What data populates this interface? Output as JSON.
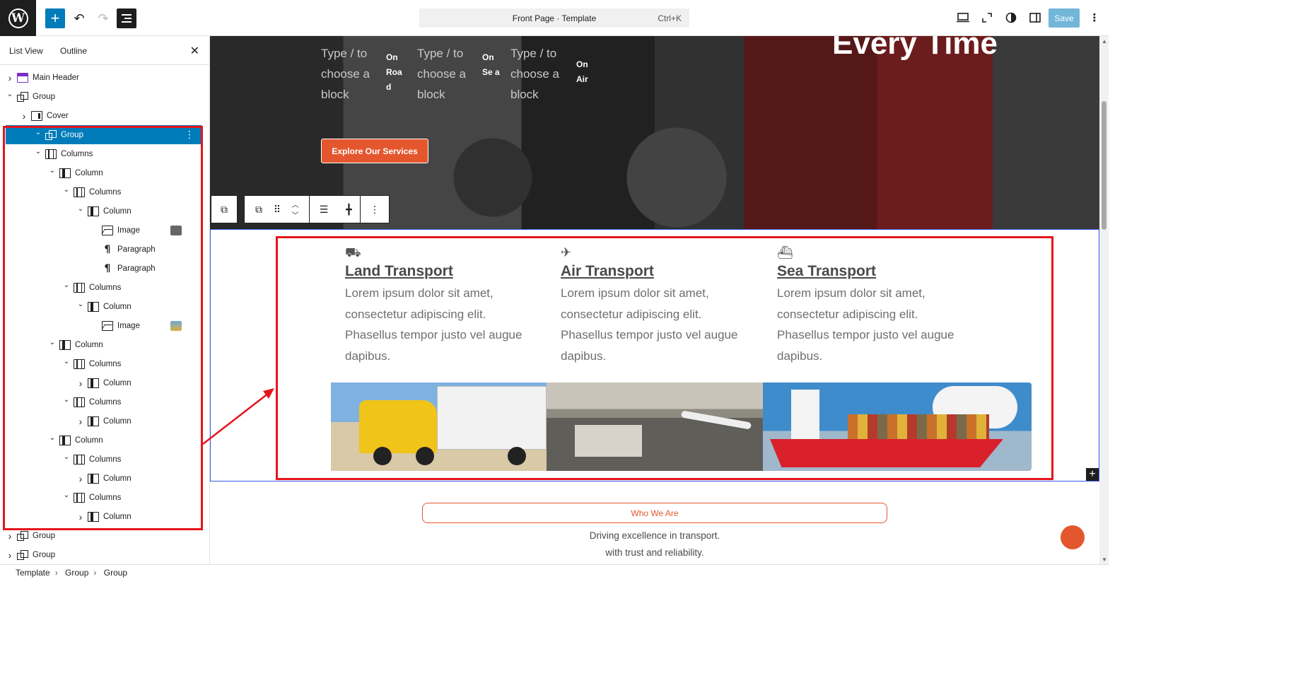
{
  "topbar": {
    "command_center_label": "Front Page · Template",
    "command_center_shortcut": "Ctrl+K",
    "save_label": "Save"
  },
  "sidebar": {
    "tabs": [
      "List View",
      "Outline"
    ],
    "items": [
      {
        "label": "Main Header",
        "icon": "template-part-header-icon",
        "chevron": "right"
      },
      {
        "label": "Group",
        "icon": "group-icon",
        "chevron": "down"
      },
      {
        "label": "Cover",
        "icon": "cover-icon",
        "chevron": "right"
      },
      {
        "label": "Group",
        "icon": "group-icon",
        "chevron": "down",
        "selected": true
      },
      {
        "label": "Columns",
        "icon": "columns-icon",
        "chevron": "down"
      },
      {
        "label": "Column",
        "icon": "column-icon",
        "chevron": "down"
      },
      {
        "label": "Columns",
        "icon": "columns-icon",
        "chevron": "down"
      },
      {
        "label": "Column",
        "icon": "column-icon",
        "chevron": "down"
      },
      {
        "label": "Image",
        "icon": "image-icon",
        "thumb": "truck-thumbnail"
      },
      {
        "label": "Paragraph",
        "icon": "paragraph-icon"
      },
      {
        "label": "Paragraph",
        "icon": "paragraph-icon"
      },
      {
        "label": "Columns",
        "icon": "columns-icon",
        "chevron": "down"
      },
      {
        "label": "Column",
        "icon": "column-icon",
        "chevron": "down"
      },
      {
        "label": "Image",
        "icon": "image-icon",
        "thumb": "photo-thumbnail"
      },
      {
        "label": "Column",
        "icon": "column-icon",
        "chevron": "down"
      },
      {
        "label": "Columns",
        "icon": "columns-icon",
        "chevron": "down"
      },
      {
        "label": "Column",
        "icon": "column-icon",
        "chevron": "right"
      },
      {
        "label": "Columns",
        "icon": "columns-icon",
        "chevron": "down"
      },
      {
        "label": "Column",
        "icon": "column-icon",
        "chevron": "right"
      },
      {
        "label": "Column",
        "icon": "column-icon",
        "chevron": "down"
      },
      {
        "label": "Columns",
        "icon": "columns-icon",
        "chevron": "down"
      },
      {
        "label": "Column",
        "icon": "column-icon",
        "chevron": "right"
      },
      {
        "label": "Columns",
        "icon": "columns-icon",
        "chevron": "down"
      },
      {
        "label": "Column",
        "icon": "column-icon",
        "chevron": "right"
      },
      {
        "label": "Group",
        "icon": "group-icon",
        "chevron": "right"
      },
      {
        "label": "Group",
        "icon": "group-icon",
        "chevron": "right"
      }
    ]
  },
  "breadcrumbs": [
    "Template",
    "Group",
    "Group"
  ],
  "hero": {
    "heading_fragment": "Every Time",
    "placeholder": "Type / to choose a block",
    "labels": [
      "On Roa d",
      "On Se a",
      "On Air"
    ],
    "button_label": "Explore Our Services"
  },
  "services": [
    {
      "icon": "truck-icon",
      "title": "Land Transport",
      "text": "Lorem ipsum dolor sit amet, consectetur adipiscing elit. Phasellus tempor justo vel augue dapibus."
    },
    {
      "icon": "plane-icon",
      "title": "Air Transport",
      "text": "Lorem ipsum dolor sit amet, consectetur adipiscing elit. Phasellus tempor justo vel augue dapibus."
    },
    {
      "icon": "ship-icon",
      "title": "Sea Transport",
      "text": "Lorem ipsum dolor sit amet, consectetur adipiscing elit. Phasellus tempor justo vel augue dapibus."
    }
  ],
  "about": {
    "badge": "Who We Are",
    "tagline_line1": "Driving excellence in transport.",
    "tagline_line2": "with trust and reliability."
  },
  "colors": {
    "accent": "#007cba",
    "brand_orange": "#e4572e",
    "annotation_red": "#e5141b",
    "selection_blue": "#3858e9"
  }
}
